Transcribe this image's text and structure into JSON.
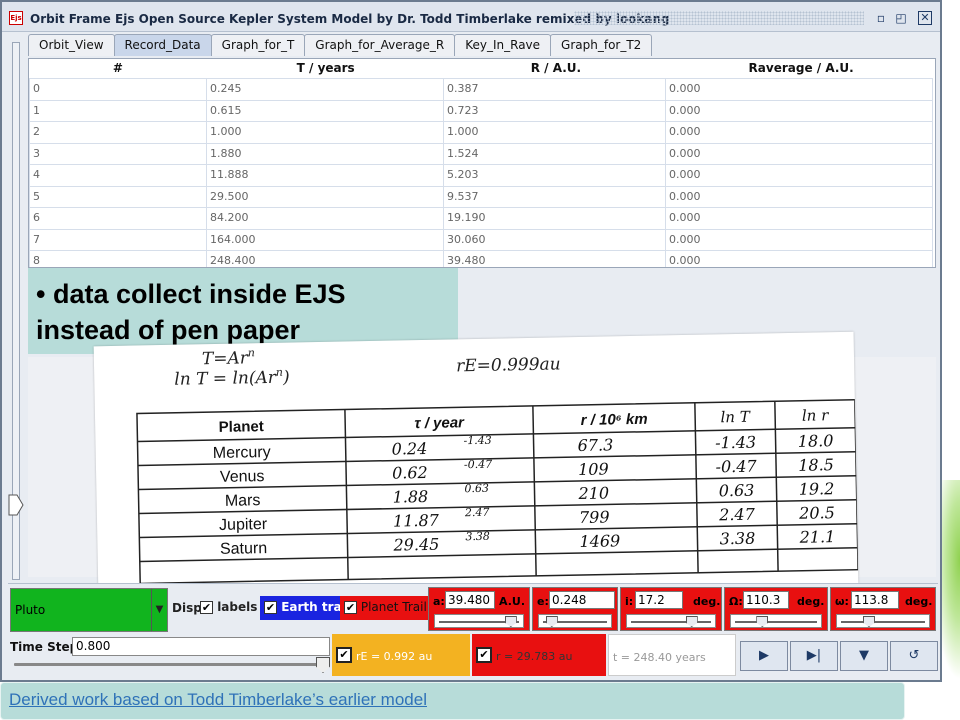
{
  "window": {
    "app_icon": "Ejs",
    "title": "Orbit Frame Ejs Open Source Kepler System Model by Dr. Todd Timberlake remixed by lookang"
  },
  "tabs": [
    {
      "label": "Orbit_View",
      "active": false
    },
    {
      "label": "Record_Data",
      "active": true
    },
    {
      "label": "Graph_for_T",
      "active": false
    },
    {
      "label": "Graph_for_Average_R",
      "active": false
    },
    {
      "label": "Key_In_Rave",
      "active": false
    },
    {
      "label": "Graph_for_T2",
      "active": false
    }
  ],
  "table": {
    "headers": [
      "#",
      "T / years",
      "R / A.U.",
      "Raverage / A.U."
    ],
    "rows": [
      [
        "0",
        "0.245",
        "0.387",
        "0.000"
      ],
      [
        "1",
        "0.615",
        "0.723",
        "0.000"
      ],
      [
        "2",
        "1.000",
        "1.000",
        "0.000"
      ],
      [
        "3",
        "1.880",
        "1.524",
        "0.000"
      ],
      [
        "4",
        "11.888",
        "5.203",
        "0.000"
      ],
      [
        "5",
        "29.500",
        "9.537",
        "0.000"
      ],
      [
        "6",
        "84.200",
        "19.190",
        "0.000"
      ],
      [
        "7",
        "164.000",
        "30.060",
        "0.000"
      ],
      [
        "8",
        "248.400",
        "39.480",
        "0.000"
      ]
    ]
  },
  "caption": {
    "line1": "• data collect inside EJS",
    "line2": "instead of pen paper"
  },
  "sheet": {
    "note_left_1": "T=Ar",
    "note_left_1_sup": "n",
    "note_left_2": "ln T = ln(Ar",
    "note_left_2_sup": "n",
    "note_left_2_end": ")",
    "note_right": "rE=0.999au",
    "headers": [
      "Planet",
      "τ / year",
      "r / 10⁶ km",
      "ln T",
      "ln r"
    ],
    "rows": [
      {
        "planet": "Mercury",
        "t": "0.24",
        "t_note": "-1.43",
        "r": "67.3",
        "lnT": "-1.43",
        "lnr": "18.0"
      },
      {
        "planet": "Venus",
        "t": "0.62",
        "t_note": "-0.47",
        "r": "109",
        "lnT": "-0.47",
        "lnr": "18.5"
      },
      {
        "planet": "Mars",
        "t": "1.88",
        "t_note": "0.63",
        "r": "210",
        "lnT": "0.63",
        "lnr": "19.2"
      },
      {
        "planet": "Jupiter",
        "t": "11.87",
        "t_note": "2.47",
        "r": "799",
        "lnT": "2.47",
        "lnr": "20.5"
      },
      {
        "planet": "Saturn",
        "t": "29.45",
        "t_note": "3.38",
        "r": "1469",
        "lnT": "3.38",
        "lnr": "21.1"
      }
    ]
  },
  "controls": {
    "planet_select": "Pluto",
    "disp_label": "Disp",
    "labels_label": "labels",
    "labels_checked": true,
    "earth_trail_label": "Earth trail",
    "earth_trail_checked": true,
    "planet_trail_label": "Planet Trail",
    "planet_trail_checked": true,
    "params": [
      {
        "label": "a:",
        "value": "39.480",
        "unit": "A.U.",
        "slider_level": 0.93
      },
      {
        "label": "e:",
        "value": "0.248",
        "unit": "",
        "slider_level": 0.1
      },
      {
        "label": "i:",
        "value": "17.2",
        "unit": "deg.",
        "slider_level": 0.78
      },
      {
        "label": "Ω:",
        "value": "110.3",
        "unit": "deg.",
        "slider_level": 0.32
      },
      {
        "label": "ω:",
        "value": "113.8",
        "unit": "deg.",
        "slider_level": 0.32
      }
    ],
    "time_step_label": "Time Step:",
    "time_step_value": "0.800",
    "time_step_slider_level": 1.0,
    "rE_text": "rE = 0.992 au",
    "r_text": "r = 29.783 au",
    "t_text": "t = 248.40 years",
    "buttons": [
      {
        "name": "play-icon",
        "glyph": "▶"
      },
      {
        "name": "step-icon",
        "glyph": "▶|"
      },
      {
        "name": "chevron-down-icon",
        "glyph": "▼"
      },
      {
        "name": "reset-icon",
        "glyph": "↺"
      }
    ]
  },
  "credit": {
    "text": "Derived work based on Todd Timberlake’s earlier model"
  },
  "colors": {
    "planet_select": "#11b41e",
    "earth_trail": "#1a24e0",
    "planet_trail": "#e81010",
    "rE_box": "#f3b221",
    "caption_bg": "#b7dcd9"
  }
}
